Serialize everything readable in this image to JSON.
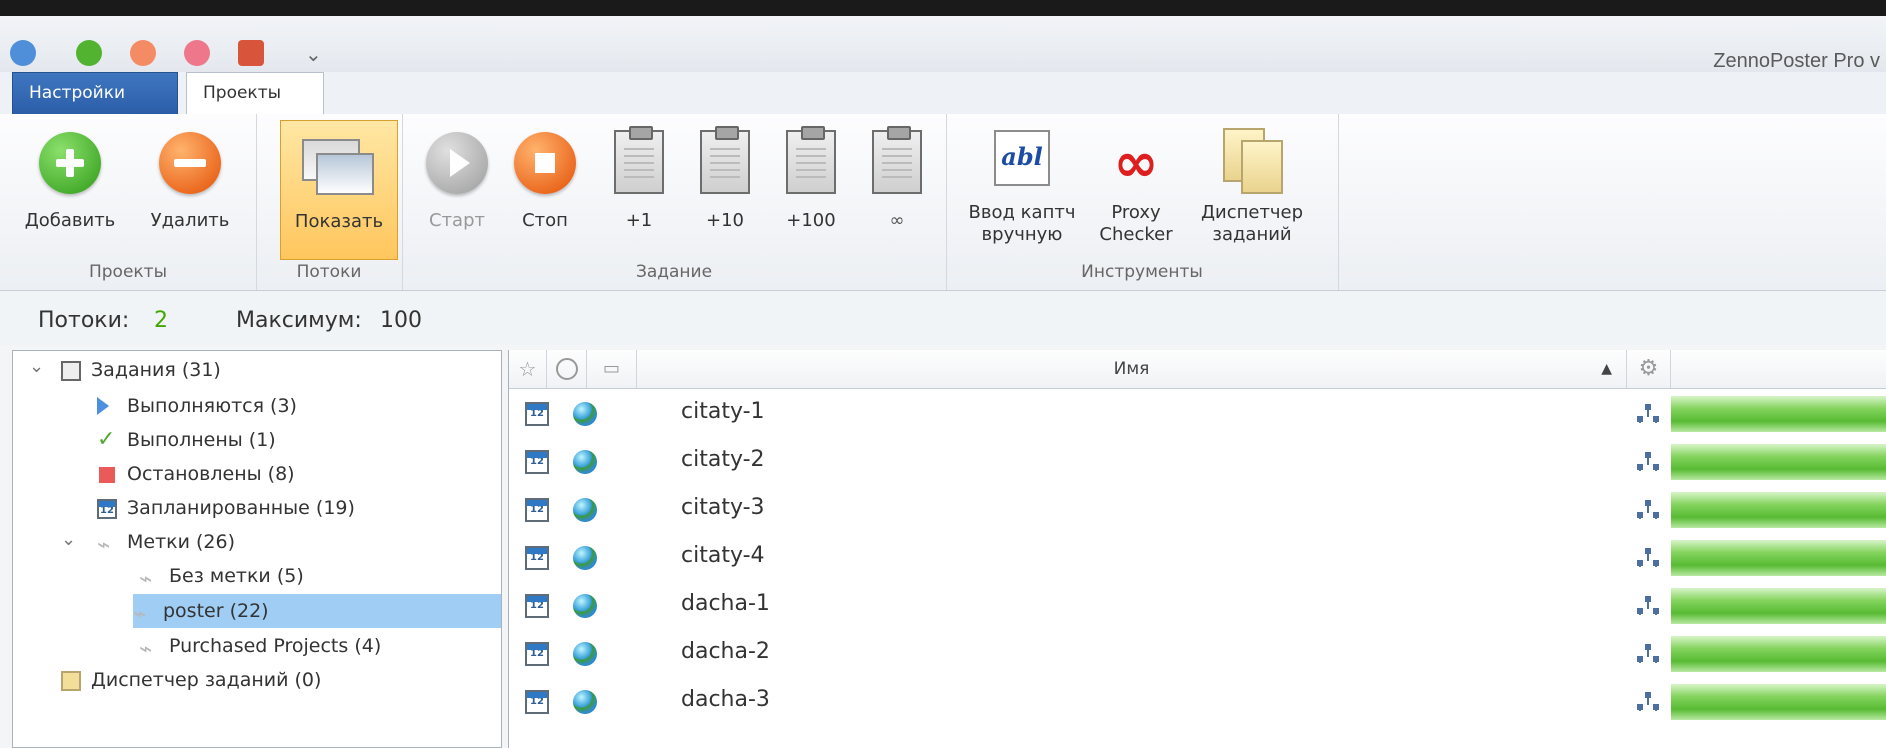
{
  "window": {
    "title": "ZennoPoster Pro v"
  },
  "ribbon": {
    "tabs": [
      {
        "label": "Настройки"
      },
      {
        "label": "Проекты"
      }
    ],
    "groups": [
      {
        "caption": "Проекты",
        "buttons": [
          {
            "label": "Добавить",
            "icon": "add-icon"
          },
          {
            "label": "Удалить",
            "icon": "remove-icon"
          }
        ]
      },
      {
        "caption": "Потоки",
        "buttons": [
          {
            "label": "Показать",
            "icon": "windows-icon"
          }
        ]
      },
      {
        "caption": "Задание",
        "buttons": [
          {
            "label": "Старт",
            "icon": "play-icon"
          },
          {
            "label": "Стоп",
            "icon": "stop-icon"
          },
          {
            "label": "+1",
            "icon": "clipboard-icon"
          },
          {
            "label": "+10",
            "icon": "clipboard-icon"
          },
          {
            "label": "+100",
            "icon": "clipboard-icon"
          },
          {
            "label": "∞",
            "icon": "clipboard-icon"
          }
        ]
      },
      {
        "caption": "Инструменты",
        "buttons": [
          {
            "label": "Ввод каптч вручную",
            "icon": "captcha-icon"
          },
          {
            "label": "Proxy Checker",
            "icon": "proxy-checker-icon"
          },
          {
            "label": "Диспетчер заданий",
            "icon": "task-manager-icon"
          }
        ]
      }
    ]
  },
  "status": {
    "threads_label": "Потоки:",
    "threads_value": "2",
    "max_label": "Максимум:",
    "max_value": "100"
  },
  "tree": {
    "items": [
      {
        "label": "Задания (31)",
        "icon": "clipboard-icon"
      },
      {
        "label": "Выполняются (3)",
        "icon": "running-icon"
      },
      {
        "label": "Выполнены (1)",
        "icon": "check-icon"
      },
      {
        "label": "Остановлены (8)",
        "icon": "stopped-icon"
      },
      {
        "label": "Запланированные (19)",
        "icon": "calendar-icon"
      },
      {
        "label": "Метки (26)",
        "icon": "tag-icon"
      },
      {
        "label": "Без метки (5)",
        "icon": "tag-icon"
      },
      {
        "label": "poster (22)",
        "icon": "tag-icon"
      },
      {
        "label": "Purchased Projects (4)",
        "icon": "tag-icon"
      },
      {
        "label": "Диспетчер заданий (0)",
        "icon": "task-manager-icon"
      }
    ]
  },
  "grid": {
    "columns": [
      {
        "label": "",
        "icon": "star-icon"
      },
      {
        "label": "",
        "icon": "globe-icon"
      },
      {
        "label": "",
        "icon": "window-icon"
      },
      {
        "label": "Имя"
      },
      {
        "label": "▲"
      },
      {
        "label": "",
        "icon": "gear-icon"
      }
    ],
    "rows": [
      {
        "name": "citaty-1",
        "progress": 1
      },
      {
        "name": "citaty-2",
        "progress": 1
      },
      {
        "name": "citaty-3",
        "progress": 1
      },
      {
        "name": "citaty-4",
        "progress": 1
      },
      {
        "name": "dacha-1",
        "progress": 1
      },
      {
        "name": "dacha-2",
        "progress": 1
      },
      {
        "name": "dacha-3",
        "progress": 1
      }
    ]
  }
}
